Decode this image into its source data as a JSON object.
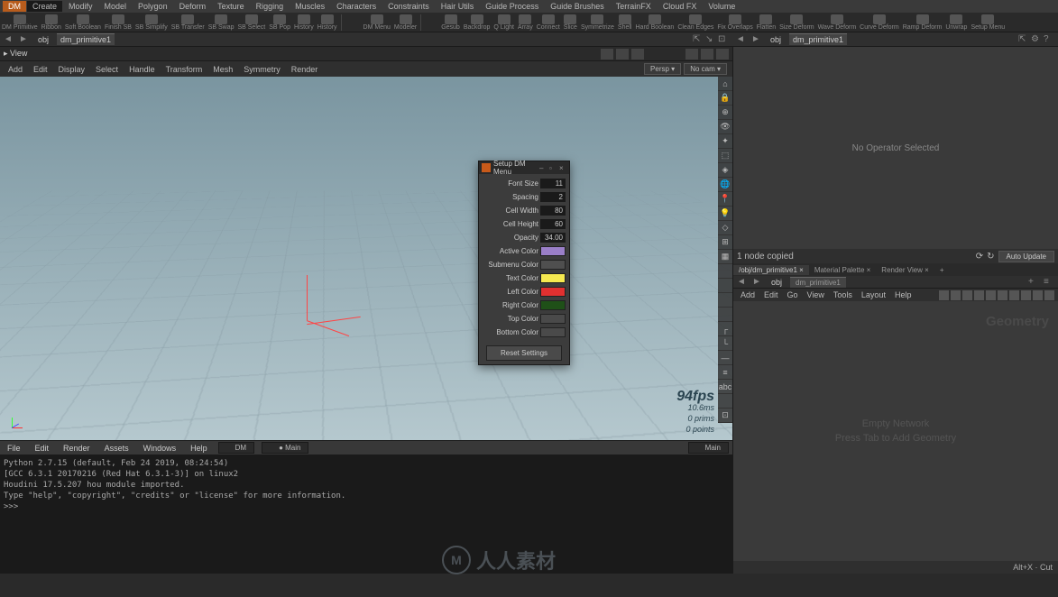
{
  "main_menu": [
    "DM",
    "Create",
    "Modify",
    "Model",
    "Polygon",
    "Deform",
    "Texture",
    "Rigging",
    "Muscles",
    "Characters",
    "Constraints",
    "Hair Utils",
    "Guide Process",
    "Guide Brushes",
    "TerrainFX",
    "Cloud FX",
    "Volume"
  ],
  "main_menu_active": 1,
  "shelf_tools_left": [
    "DM Primitive",
    "Ribbon",
    "Soft Boolean",
    "Finish SB",
    "SB Simplify",
    "SB Transfer",
    "SB Swap",
    "SB Select",
    "SB Pop",
    "History",
    "History"
  ],
  "shelf_tools_mid": [
    "DM Menu",
    "Modeler"
  ],
  "shelf_tools_right": [
    "Gesub",
    "Backdrop",
    "Q Light",
    "Array",
    "Connect",
    "Slice",
    "Symmetrize",
    "Shell",
    "Hard Boolean",
    "Clean Edges",
    "Fix Overlaps",
    "Flatten",
    "Size Deform",
    "Wave Deform",
    "Curve Deform",
    "Ramp Deform",
    "Unwrap",
    "Setup Menu"
  ],
  "path": {
    "obj": "obj",
    "node": "dm_primitive1"
  },
  "right_path": {
    "obj": "obj",
    "node": "dm_primitive1"
  },
  "viewport": {
    "title": "View",
    "menu": [
      "Add",
      "Edit",
      "Display",
      "Select",
      "Handle",
      "Transform",
      "Mesh",
      "Symmetry",
      "Render"
    ],
    "cam_a": "Persp ▾",
    "cam_b": "No cam ▾",
    "fps": "94fps",
    "ms": "10.6ms",
    "prims": "0 prims",
    "points": "0 points"
  },
  "bottom_menu": [
    "File",
    "Edit",
    "Render",
    "Assets",
    "Windows",
    "Help"
  ],
  "bottom": {
    "dm": "DM",
    "main_a": "Main",
    "main_b": "Main"
  },
  "console_lines": [
    "Python 2.7.15 (default, Feb 24 2019, 08:24:54)",
    "[GCC 6.3.1 20170216 (Red Hat 6.3.1-3)] on linux2",
    "Houdini 17.5.207 hou module imported.",
    "Type \"help\", \"copyright\", \"credits\" or \"license\" for more information.",
    ">>>"
  ],
  "params": {
    "empty": "No Operator Selected",
    "status": "1 node copied",
    "auto": "Auto Update"
  },
  "net": {
    "tabs": [
      "/obj/dm_primitive1",
      "Material Palette",
      "Render View"
    ],
    "path_obj": "obj",
    "path_node": "dm_primitive1",
    "menu": [
      "Add",
      "Edit",
      "Go",
      "View",
      "Tools",
      "Layout",
      "Help"
    ],
    "title": "Geometry",
    "empty1": "Empty Network",
    "empty2": "Press Tab to Add Geometry",
    "shortcut": "Alt+X · Cut"
  },
  "dialog": {
    "title": "Setup DM Menu",
    "rows": [
      {
        "label": "Font Size",
        "value": "11"
      },
      {
        "label": "Spacing",
        "value": "2"
      },
      {
        "label": "Cell Width",
        "value": "80"
      },
      {
        "label": "Cell Height",
        "value": "60"
      },
      {
        "label": "Opacity",
        "value": "34.00"
      }
    ],
    "colors": [
      {
        "label": "Active Color",
        "hex": "#9a7fc8"
      },
      {
        "label": "Submenu Color",
        "hex": "#4f4f4f"
      },
      {
        "label": "Text Color",
        "hex": "#f5e950"
      },
      {
        "label": "Left Color",
        "hex": "#e03030"
      },
      {
        "label": "Right Color",
        "hex": "#1f5018"
      },
      {
        "label": "Top Color",
        "hex": "#4a4a4a"
      },
      {
        "label": "Bottom Color",
        "hex": "#4a4a4a"
      }
    ],
    "reset": "Reset Settings"
  },
  "watermark": "人人素材"
}
